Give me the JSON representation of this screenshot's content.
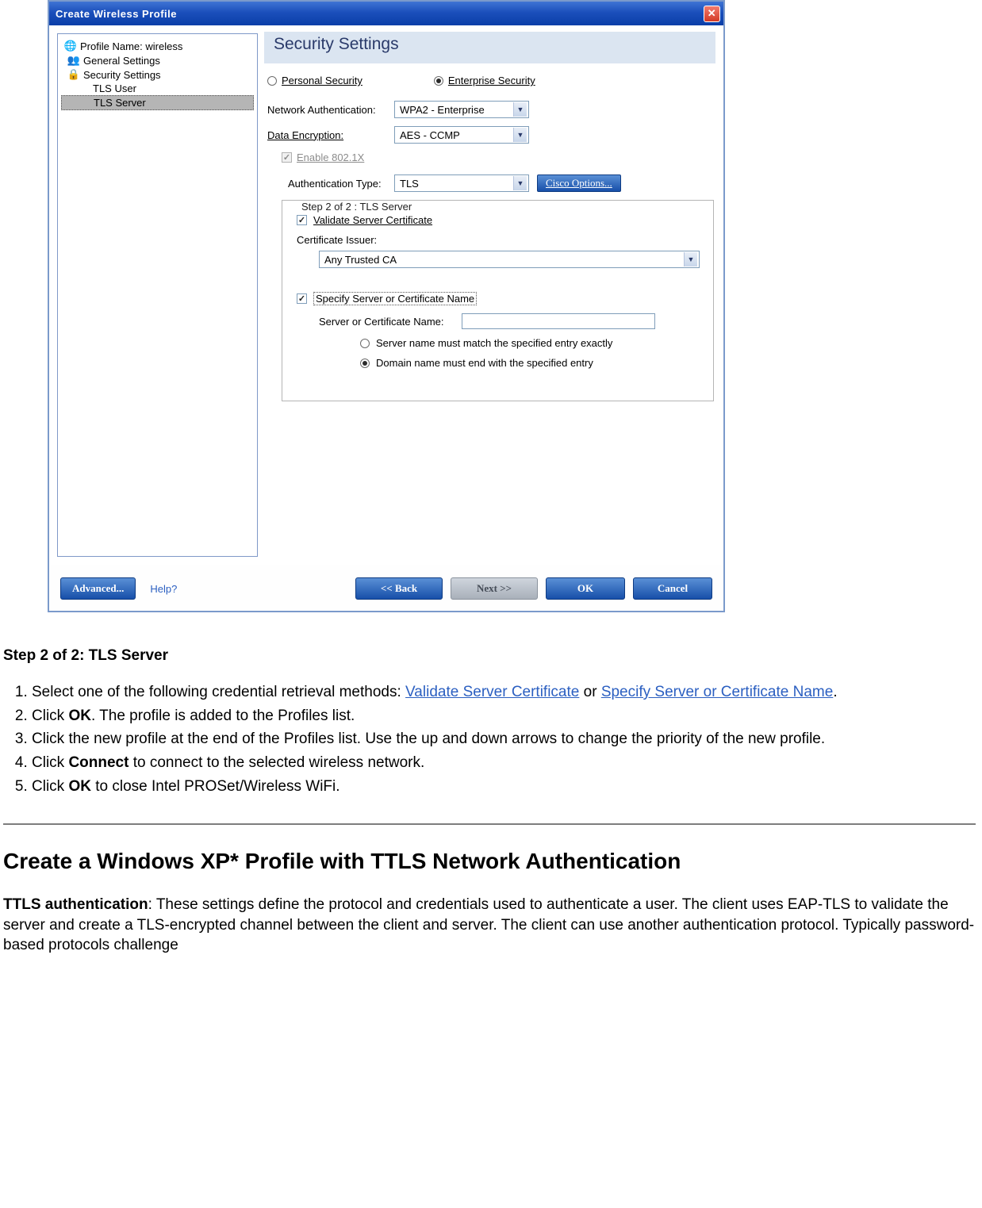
{
  "dialog": {
    "title": "Create Wireless Profile",
    "tree": {
      "profile_name_label": "Profile Name:",
      "profile_name_value": "wireless",
      "general_settings": "General Settings",
      "security_settings": "Security Settings",
      "tls_user": "TLS User",
      "tls_server": "TLS Server"
    },
    "right": {
      "heading": "Security Settings",
      "personal_security": "Personal Security",
      "enterprise_security": "Enterprise Security",
      "net_auth_label": "Network Authentication:",
      "net_auth_value": "WPA2 - Enterprise",
      "data_enc_label": "Data Encryption:",
      "data_enc_value": "AES - CCMP",
      "enable_8021x": "Enable 802.1X",
      "auth_type_label": "Authentication Type:",
      "auth_type_value": "TLS",
      "cisco_btn": "Cisco Options...",
      "step_legend": "Step 2 of 2 : TLS Server",
      "validate_server_cert": "Validate Server Certificate",
      "cert_issuer_label": "Certificate Issuer:",
      "cert_issuer_value": "Any Trusted CA",
      "specify_server_label": "Specify Server or Certificate Name",
      "server_cert_name_label": "Server or Certificate Name:",
      "server_cert_name_value": "",
      "radio_match": "Server name must match the specified entry exactly",
      "radio_domain": "Domain name must end with the specified entry"
    },
    "buttons": {
      "advanced": "Advanced...",
      "help": "Help?",
      "back": "<< Back",
      "next": "Next >>",
      "ok": "OK",
      "cancel": "Cancel"
    }
  },
  "doc": {
    "step_heading": "Step 2 of 2: TLS Server",
    "li1_a": "Select one of the following credential retrieval methods: ",
    "li1_link1": "Validate Server Certificate",
    "li1_b": " or ",
    "li1_link2": "Specify Server or Certificate Name",
    "li1_c": ".",
    "li2_a": "Click ",
    "li2_b": "OK",
    "li2_c": ". The profile is added to the Profiles list.",
    "li3": "Click the new profile at the end of the Profiles list. Use the up and down arrows to change the priority of the new profile.",
    "li4_a": "Click ",
    "li4_b": "Connect",
    "li4_c": " to connect to the selected wireless network.",
    "li5_a": "Click ",
    "li5_b": "OK",
    "li5_c": " to close Intel PROSet/Wireless WiFi.",
    "h2": "Create a Windows XP* Profile with TTLS Network Authentication",
    "p1_a": "TTLS authentication",
    "p1_b": ": These settings define the protocol and credentials used to authenticate a user. The client uses EAP-TLS to validate the server and create a TLS-encrypted channel between the client and server. The client can use another authentication protocol. Typically password-based protocols challenge"
  }
}
